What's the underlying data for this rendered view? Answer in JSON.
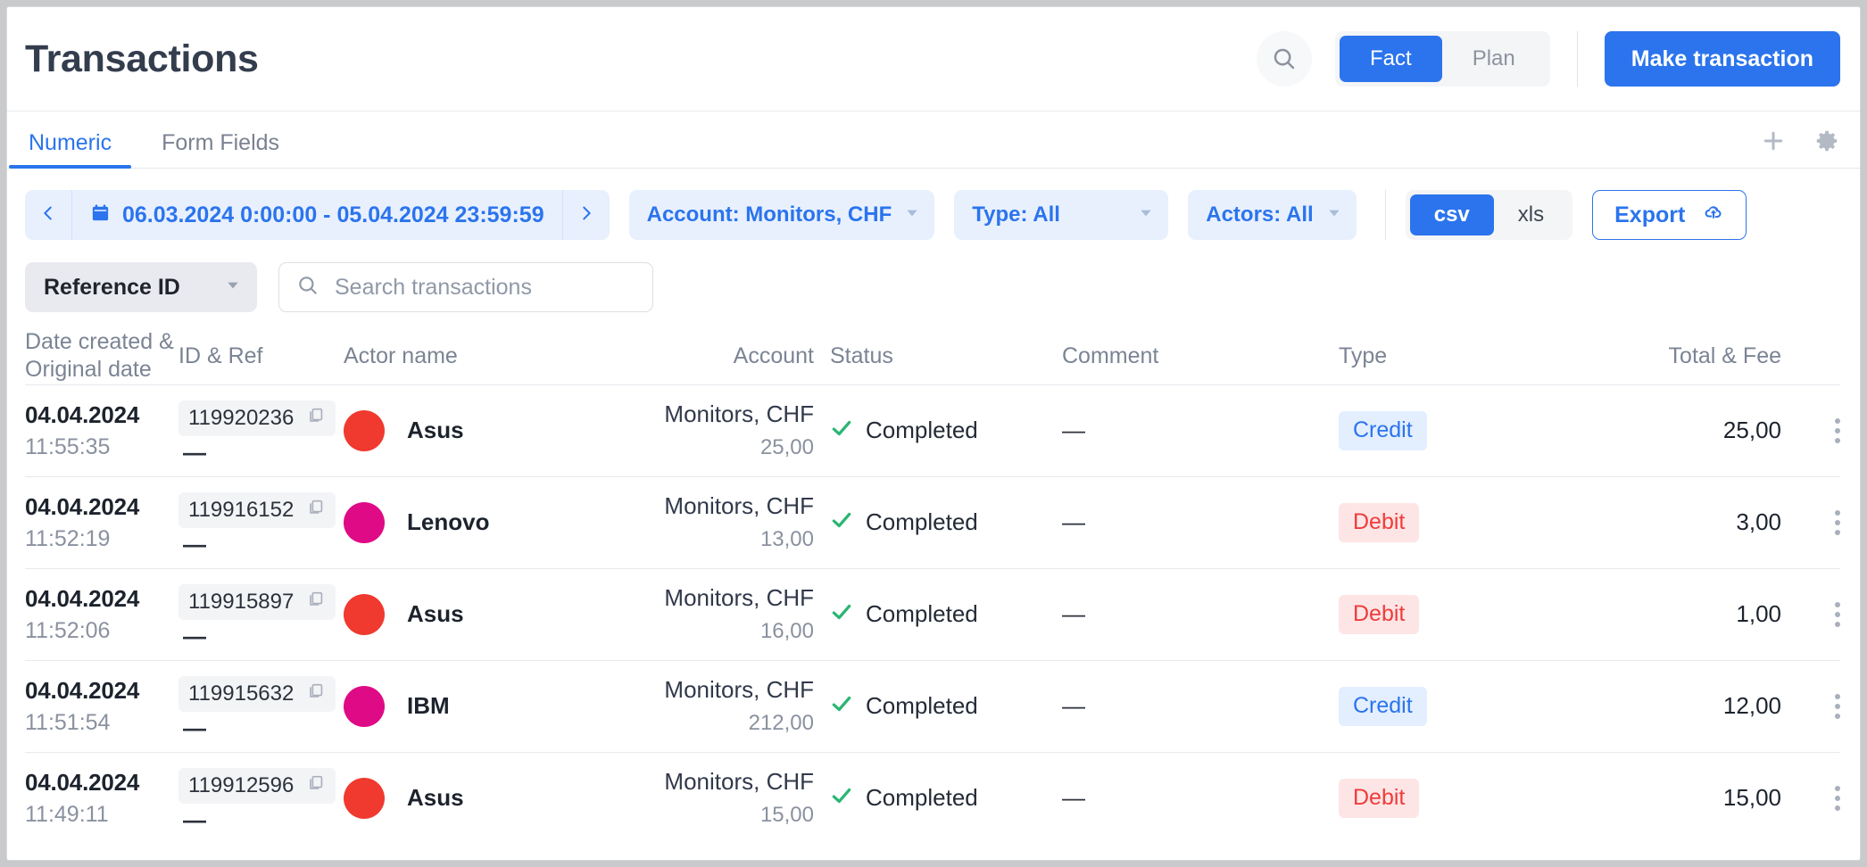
{
  "header": {
    "title": "Transactions",
    "search_icon": "search-icon",
    "segmented": {
      "options": [
        "Fact",
        "Plan"
      ],
      "selected": "Fact"
    },
    "primary_button": "Make transaction"
  },
  "tabs": {
    "items": [
      {
        "label": "Numeric",
        "active": true
      },
      {
        "label": "Form Fields",
        "active": false
      }
    ],
    "actions": [
      {
        "icon": "plus-icon"
      },
      {
        "icon": "gear-icon"
      }
    ]
  },
  "filters": {
    "date_range": {
      "prev_icon": "chevron-left-icon",
      "calendar_icon": "calendar-icon",
      "text": "06.03.2024 0:00:00 - 05.04.2024 23:59:59",
      "next_icon": "chevron-right-icon"
    },
    "chips": [
      {
        "label": "Account: Monitors, CHF"
      },
      {
        "label": "Type: All"
      },
      {
        "label": "Actors: All"
      }
    ],
    "format": {
      "options": [
        "csv",
        "xls"
      ],
      "selected": "csv"
    },
    "export_label": "Export",
    "export_icon": "upload-cloud-icon"
  },
  "search": {
    "field_selector": "Reference ID",
    "placeholder": "Search transactions",
    "value": "",
    "search_icon": "search-icon"
  },
  "table": {
    "columns": [
      "Date created & Original date",
      "ID & Ref",
      "Actor name",
      "Account",
      "Status",
      "Comment",
      "Type",
      "Total & Fee"
    ],
    "rows": [
      {
        "date": "04.04.2024",
        "time": "11:55:35",
        "id": "119920236",
        "ref": "—",
        "actor": "Asus",
        "avatar_color": "#f0392f",
        "account": "Monitors, CHF",
        "account_amount": "25,00",
        "status": "Completed",
        "comment": "—",
        "type": "Credit",
        "type_kind": "credit",
        "total": "25,00"
      },
      {
        "date": "04.04.2024",
        "time": "11:52:19",
        "id": "119916152",
        "ref": "—",
        "actor": "Lenovo",
        "avatar_color": "#df0a86",
        "account": "Monitors, CHF",
        "account_amount": "13,00",
        "status": "Completed",
        "comment": "—",
        "type": "Debit",
        "type_kind": "debit",
        "total": "3,00"
      },
      {
        "date": "04.04.2024",
        "time": "11:52:06",
        "id": "119915897",
        "ref": "—",
        "actor": "Asus",
        "avatar_color": "#f0392f",
        "account": "Monitors, CHF",
        "account_amount": "16,00",
        "status": "Completed",
        "comment": "—",
        "type": "Debit",
        "type_kind": "debit",
        "total": "1,00"
      },
      {
        "date": "04.04.2024",
        "time": "11:51:54",
        "id": "119915632",
        "ref": "—",
        "actor": "IBM",
        "avatar_color": "#df0a86",
        "account": "Monitors, CHF",
        "account_amount": "212,00",
        "status": "Completed",
        "comment": "—",
        "type": "Credit",
        "type_kind": "credit",
        "total": "12,00"
      },
      {
        "date": "04.04.2024",
        "time": "11:49:11",
        "id": "119912596",
        "ref": "—",
        "actor": "Asus",
        "avatar_color": "#f0392f",
        "account": "Monitors, CHF",
        "account_amount": "15,00",
        "status": "Completed",
        "comment": "—",
        "type": "Debit",
        "type_kind": "debit",
        "total": "15,00"
      }
    ]
  },
  "colors": {
    "accent": "#2b74ed",
    "success": "#2bb673",
    "debit": "#f03b3b",
    "credit": "#2b74ed"
  }
}
